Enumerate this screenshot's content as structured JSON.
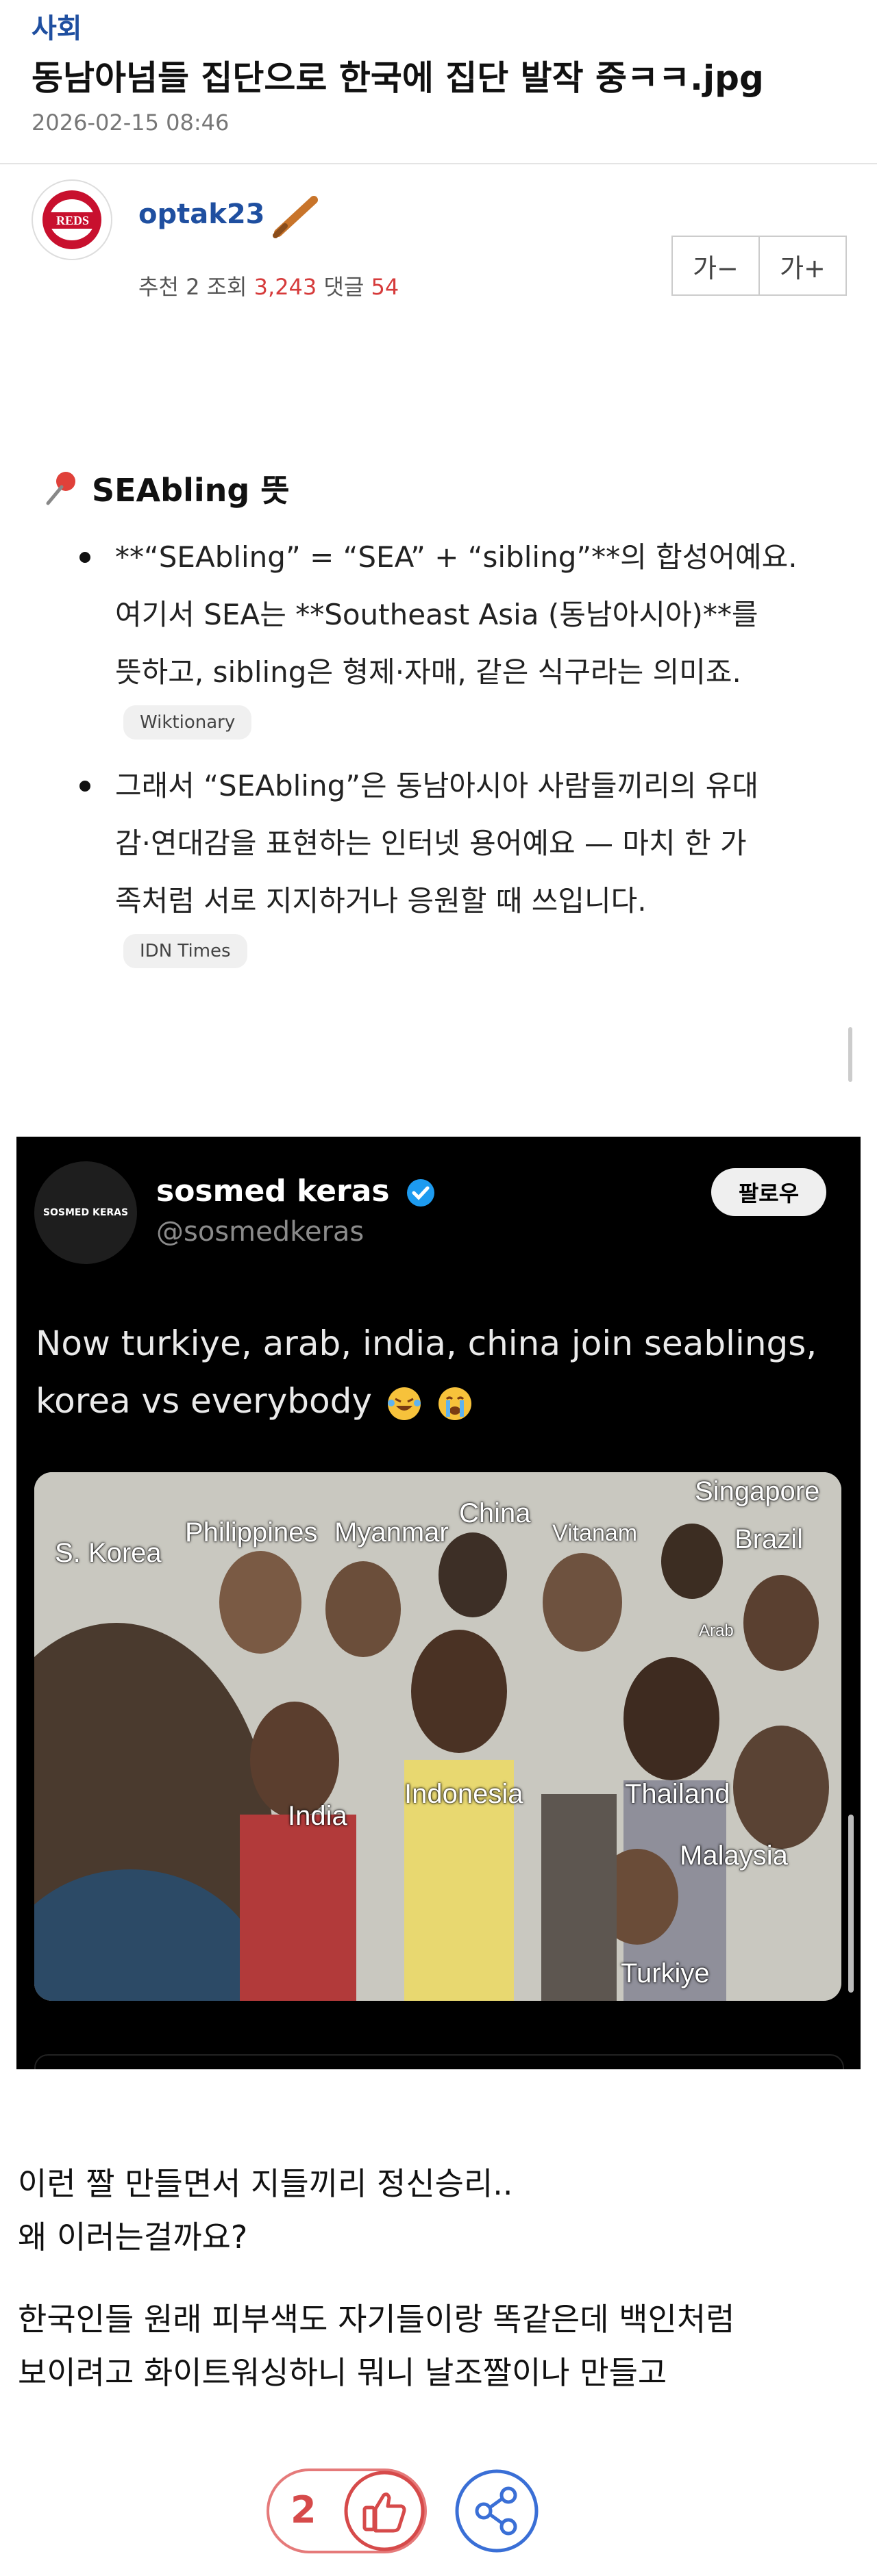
{
  "post": {
    "category": "사회",
    "title": "동남아넘들 집단으로 한국에 집단 발작 중ㅋㅋ.jpg",
    "datetime": "2026-02-15 08:46"
  },
  "author": {
    "username": "optak23",
    "recommend_label": "추천",
    "recommend_count": "2",
    "views_label": "조회",
    "views_count": "3,243",
    "comments_label": "댓글",
    "comments_count": "54"
  },
  "font_controls": {
    "decrease": "가−",
    "increase": "가+"
  },
  "embed": {
    "heading": "SEAbling 뜻",
    "bullets": [
      {
        "line1": "**“SEAbling” = “SEA” + “sibling”**의 합성어예요.",
        "line2": "여기서 SEA는 **Southeast Asia (동남아시아)**를",
        "line3": "뜻하고, sibling은 형제·자매, 같은 식구라는 의미죠.",
        "source": "Wiktionary"
      },
      {
        "line1": "그래서 “SEAbling”은 동남아시아 사람들끼리의 유대",
        "line2": "감·연대감을 표현하는 인터넷 용어예요 — 마치 한 가",
        "line3": "족처럼 서로 지지하거나 응원할 때 쓰입니다.",
        "source": "IDN Times"
      }
    ]
  },
  "tweet": {
    "avatar_text": "SOSMED KERAS",
    "name": "sosmed keras",
    "handle": "@sosmedkeras",
    "follow_label": "팔로우",
    "text_line1": "Now turkiye, arab, india, china join seablings,",
    "text_line2": "korea vs everybody",
    "photo_labels": {
      "s_korea": "S. Korea",
      "philippines": "Philippines",
      "myanmar": "Myanmar",
      "china": "China",
      "vitanam": "Vitanam",
      "singapore": "Singapore",
      "brazil": "Brazil",
      "arab": "Arab",
      "india": "India",
      "indonesia": "Indonesia",
      "thailand": "Thailand",
      "malaysia": "Malaysia",
      "turkiye": "Turkiye"
    }
  },
  "body": {
    "p1_line1": "이런 짤 만들면서 지들끼리 정신승리..",
    "p1_line2": "왜 이러는걸까요?",
    "p2_line1": "한국인들 원래 피부색도 자기들이랑 똑같은데 백인처럼",
    "p2_line2": "보이려고 화이트워싱하니 뭐니 날조짤이나 만들고"
  },
  "actions": {
    "like_count": "2"
  },
  "colors": {
    "accent_blue": "#1f4fa0",
    "like_red": "#d64a4a",
    "share_blue": "#3a6fd6"
  }
}
